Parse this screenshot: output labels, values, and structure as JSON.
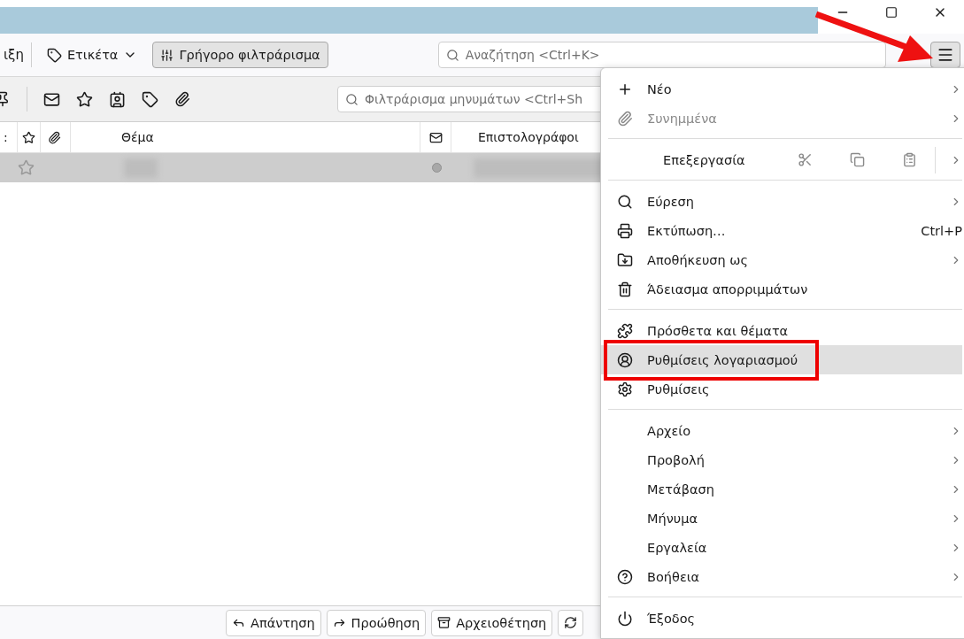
{
  "toolbar": {
    "cut_label": "ιξη",
    "tag_button": {
      "label": "Ετικέτα"
    },
    "quick_filter": {
      "label": "Γρήγορο φιλτράρισμα",
      "pressed": true
    },
    "search": {
      "placeholder": "Αναζήτηση <Ctrl+K>"
    },
    "menu_button": {
      "pressed": true
    }
  },
  "filter_bar": {
    "placeholder": "Φιλτράρισμα μηνυμάτων <Ctrl+Sh"
  },
  "table": {
    "columns": [
      {
        "label": ":"
      },
      {
        "kind": "star"
      },
      {
        "kind": "attachment"
      },
      {
        "label": "Θέμα"
      },
      {
        "kind": "read"
      },
      {
        "label": "Επιστολογράφοι"
      }
    ],
    "rows": [
      {
        "selected": true,
        "starred": false
      }
    ]
  },
  "action_buttons": [
    {
      "label": "Απάντηση"
    },
    {
      "label": "Προώθηση"
    },
    {
      "label": "Αρχειοθέτηση"
    }
  ],
  "menu": {
    "items": [
      {
        "kind": "item",
        "label": "Νέο",
        "submenu": true,
        "disabled": false,
        "selected": false
      },
      {
        "kind": "item",
        "label": "Συνημμένα",
        "submenu": true,
        "disabled": true,
        "selected": false
      },
      {
        "kind": "separator"
      },
      {
        "kind": "edit",
        "label": "Επεξεργασία",
        "submenu": true,
        "disabled": false,
        "selected": false
      },
      {
        "kind": "separator"
      },
      {
        "kind": "item",
        "label": "Εύρεση",
        "submenu": true,
        "disabled": false,
        "selected": false
      },
      {
        "kind": "item",
        "label": "Εκτύπωση…",
        "shortcut": "Ctrl+P",
        "submenu": false,
        "disabled": false,
        "selected": false
      },
      {
        "kind": "item",
        "label": "Αποθήκευση ως",
        "submenu": true,
        "disabled": false,
        "selected": false
      },
      {
        "kind": "item",
        "label": "Άδειασμα απορριμμάτων",
        "submenu": false,
        "disabled": false,
        "selected": false
      },
      {
        "kind": "separator"
      },
      {
        "kind": "item",
        "label": "Πρόσθετα και θέματα",
        "submenu": false,
        "disabled": false,
        "selected": false
      },
      {
        "kind": "item",
        "label": "Ρυθμίσεις λογαριασμού",
        "submenu": false,
        "disabled": false,
        "selected": true
      },
      {
        "kind": "item",
        "label": "Ρυθμίσεις",
        "submenu": false,
        "disabled": false,
        "selected": false
      },
      {
        "kind": "separator"
      },
      {
        "kind": "item",
        "label": "Αρχείο",
        "submenu": true,
        "disabled": false,
        "selected": false
      },
      {
        "kind": "item",
        "label": "Προβολή",
        "submenu": true,
        "disabled": false,
        "selected": false
      },
      {
        "kind": "item",
        "label": "Μετάβαση",
        "submenu": true,
        "disabled": false,
        "selected": false
      },
      {
        "kind": "item",
        "label": "Μήνυμα",
        "submenu": true,
        "disabled": false,
        "selected": false
      },
      {
        "kind": "item",
        "label": "Εργαλεία",
        "submenu": true,
        "disabled": false,
        "selected": false
      },
      {
        "kind": "item",
        "label": "Βοήθεια",
        "submenu": true,
        "disabled": false,
        "selected": false
      },
      {
        "kind": "separator"
      },
      {
        "kind": "item",
        "label": "Έξοδος",
        "submenu": false,
        "disabled": false,
        "selected": false
      }
    ]
  }
}
